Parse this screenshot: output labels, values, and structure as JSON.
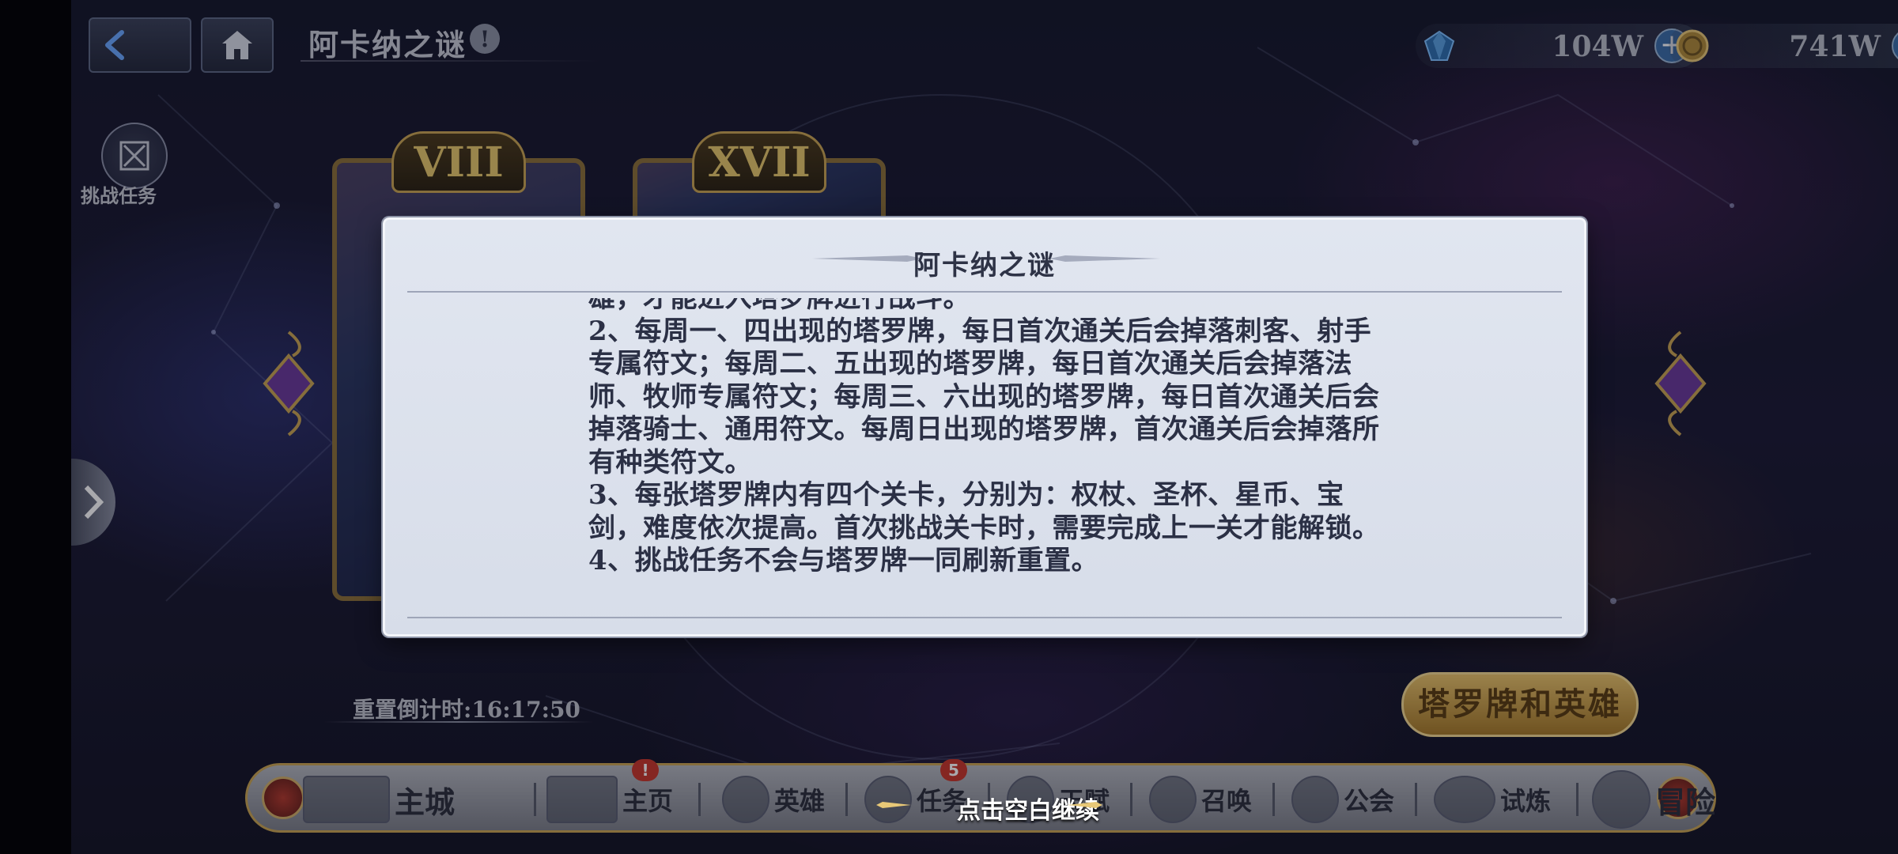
{
  "header": {
    "title": "阿卡纳之谜",
    "info_icon": "!",
    "currencies": [
      {
        "icon": "blue-gem-icon",
        "value": "104W"
      },
      {
        "icon": "gold-coin-icon",
        "value": "741W"
      }
    ]
  },
  "left_panel": {
    "challenge_label": "挑战任务"
  },
  "tarot_cards": [
    {
      "numeral": "VIII"
    },
    {
      "numeral": "XVII"
    }
  ],
  "reset_countdown": "重置倒计时:16:17:50",
  "tarot_heroes_button": "塔罗牌和英雄",
  "modal": {
    "title": "阿卡纳之谜",
    "paragraphs": [
      "雄，才能进入塔罗牌进行战斗。",
      "2、每周一、四出现的塔罗牌，每日首次通关后会掉落刺客、射手专属符文；每周二、五出现的塔罗牌，每日首次通关后会掉落法师、牧师专属符文；每周三、六出现的塔罗牌，每日首次通关后会掉落骑士、通用符文。每周日出现的塔罗牌，首次通关后会掉落所有种类符文。",
      "3、每张塔罗牌内有四个关卡，分别为：权杖、圣杯、星币、宝剑，难度依次提高。首次挑战关卡时，需要完成上一关才能解锁。",
      "4、挑战任务不会与塔罗牌一同刷新重置。"
    ]
  },
  "continue_hint": "点击空白继续",
  "bottom_nav": {
    "items": [
      {
        "label": "主城"
      },
      {
        "label": "主页",
        "badge": "!"
      },
      {
        "label": "英雄"
      },
      {
        "label": "任务",
        "badge": "5"
      },
      {
        "label": "天赋"
      },
      {
        "label": "召唤"
      },
      {
        "label": "公会"
      },
      {
        "label": "试炼"
      },
      {
        "label": "冒险"
      }
    ]
  },
  "colors": {
    "accent_gold": "#c9a552",
    "badge_red": "#c8362a",
    "modal_bg": "#dfe4ee"
  }
}
